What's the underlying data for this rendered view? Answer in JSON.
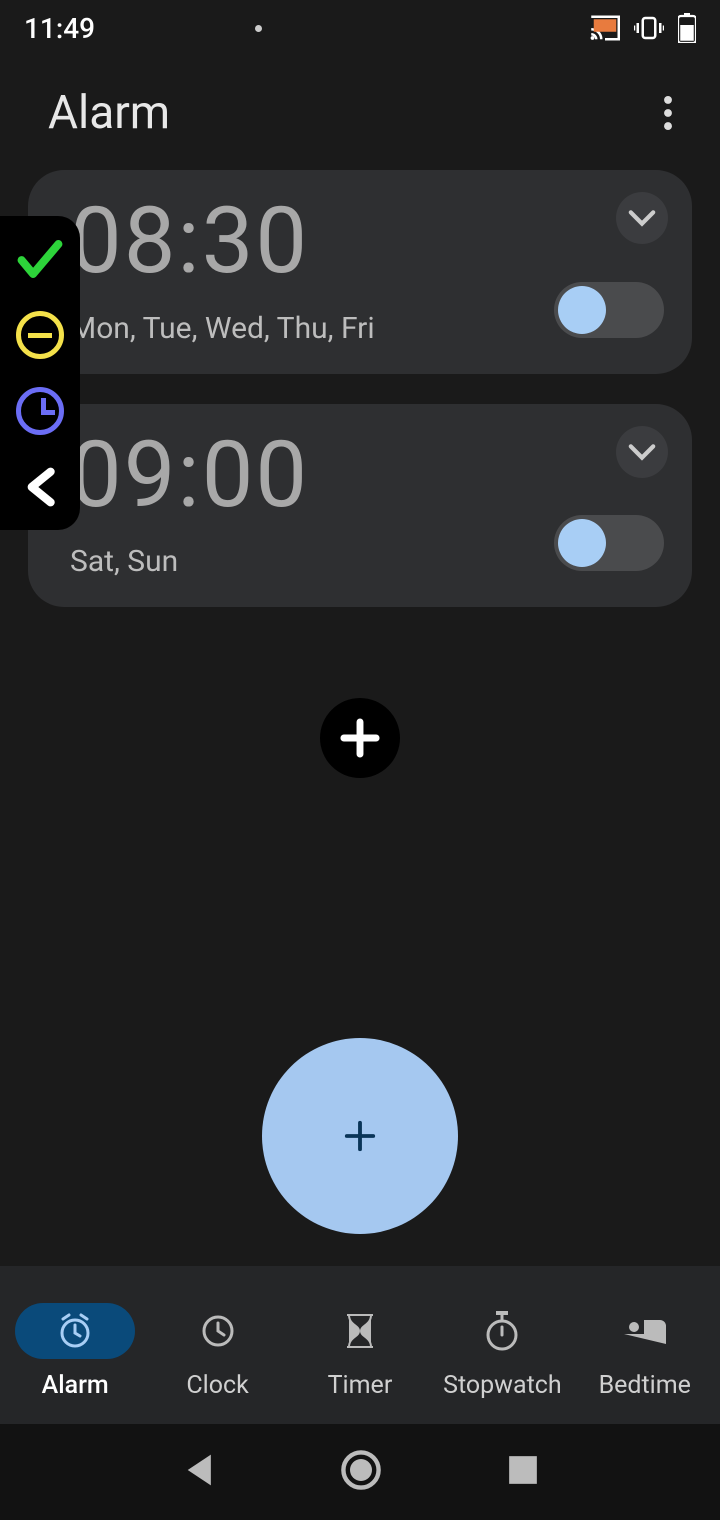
{
  "status": {
    "time": "11:49"
  },
  "header": {
    "title": "Alarm"
  },
  "alarms": [
    {
      "time": "08:30",
      "days": "Mon, Tue, Wed, Thu, Fri",
      "enabled": false
    },
    {
      "time": "09:00",
      "days": "Sat, Sun",
      "enabled": false
    }
  ],
  "nav": {
    "items": [
      {
        "key": "alarm",
        "label": "Alarm",
        "active": true
      },
      {
        "key": "clock",
        "label": "Clock",
        "active": false
      },
      {
        "key": "timer",
        "label": "Timer",
        "active": false
      },
      {
        "key": "stopwatch",
        "label": "Stopwatch",
        "active": false
      },
      {
        "key": "bedtime",
        "label": "Bedtime",
        "active": false
      }
    ]
  },
  "colors": {
    "card_bg": "#2e2f31",
    "fab": "#a5c8f0",
    "nav_active_pill": "#0a4a7a",
    "toggle_knob": "#a8cef5"
  }
}
